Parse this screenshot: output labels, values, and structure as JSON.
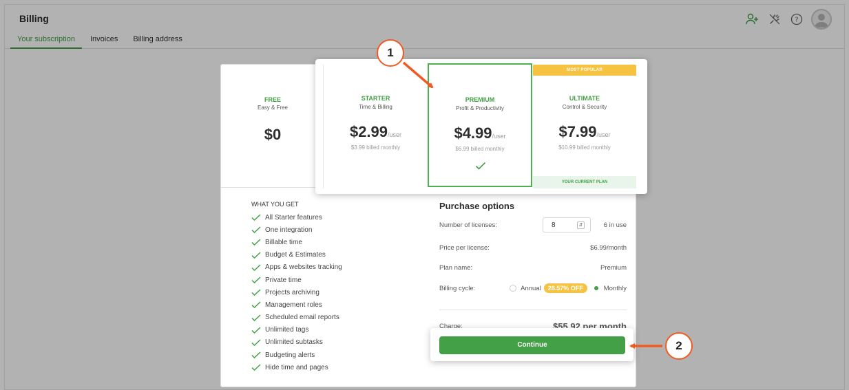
{
  "header": {
    "title": "Billing",
    "tabs": [
      {
        "label": "Your subscription",
        "active": true
      },
      {
        "label": "Invoices",
        "active": false
      },
      {
        "label": "Billing address",
        "active": false
      }
    ],
    "icons": [
      "add-user-icon",
      "plug-disconnected-icon",
      "help-icon",
      "avatar-icon"
    ]
  },
  "plans": {
    "free": {
      "name": "FREE",
      "subtitle": "Easy & Free",
      "price": "$0"
    },
    "starter": {
      "name": "STARTER",
      "subtitle": "Time & Billing",
      "price": "$2.99",
      "unit": "/user",
      "billed": "$3.99 billed monthly"
    },
    "premium": {
      "name": "PREMIUM",
      "subtitle": "Profit & Productivity",
      "price": "$4.99",
      "unit": "/user",
      "billed": "$6.99 billed monthly",
      "selected": true
    },
    "ultimate": {
      "name": "ULTIMATE",
      "subtitle": "Control & Security",
      "price": "$7.99",
      "unit": "/user",
      "billed": "$10.99 billed monthly",
      "badge": "MOST POPULAR",
      "current": "YOUR CURRENT PLAN"
    }
  },
  "features": {
    "title": "WHAT YOU GET",
    "items": [
      "All Starter features",
      "One integration",
      "Billable time",
      "Budget & Estimates",
      "Apps & websites tracking",
      "Private time",
      "Projects archiving",
      "Management roles",
      "Scheduled email reports",
      "Unlimited tags",
      "Unlimited subtasks",
      "Budgeting alerts",
      "Hide time and pages"
    ]
  },
  "purchase": {
    "title": "Purchase options",
    "licenses_label": "Number of licenses:",
    "licenses_value": "8",
    "in_use": "6 in use",
    "price_label": "Price per license:",
    "price_value": "$6.99/month",
    "plan_label": "Plan name:",
    "plan_value": "Premium",
    "cycle_label": "Billing cycle:",
    "cycle_annual": "Annual",
    "cycle_discount": "28.57% OFF",
    "cycle_monthly": "Monthly",
    "cycle_selected": "Monthly",
    "charge_label": "Charge:",
    "charge_value": "$55.92 per month",
    "continue_label": "Continue"
  },
  "callouts": [
    "1",
    "2"
  ],
  "colors": {
    "accent": "#43a047",
    "callout": "#f15a22",
    "badge": "#f5c242"
  }
}
